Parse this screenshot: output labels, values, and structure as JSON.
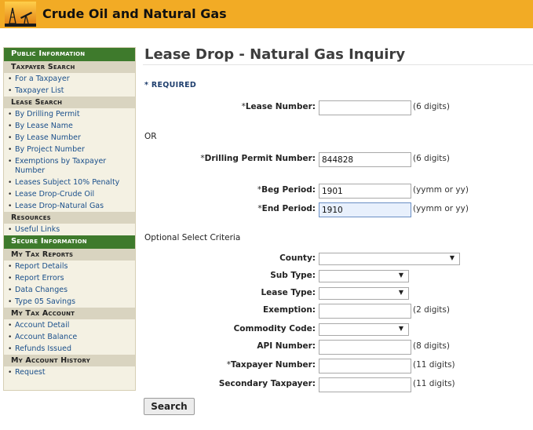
{
  "header": {
    "title": "Crude Oil and Natural Gas",
    "logo_icon": "oil-derrick-icon",
    "color": "#f2ab25"
  },
  "sidebar": {
    "public_heading": "Public Information",
    "taxpayer_search": {
      "heading": "Taxpayer Search",
      "items": [
        "For a Taxpayer",
        "Taxpayer List"
      ]
    },
    "lease_search": {
      "heading": "Lease Search",
      "items": [
        "By Drilling Permit",
        "By Lease Name",
        "By Lease Number",
        "By Project Number",
        "Exemptions by Taxpayer Number",
        "Leases Subject 10% Penalty",
        "Lease Drop-Crude Oil",
        "Lease Drop-Natural Gas"
      ]
    },
    "resources": {
      "heading": "Resources",
      "items": [
        "Useful Links"
      ]
    },
    "secure_heading": "Secure Information",
    "my_tax_reports": {
      "heading": "My Tax Reports",
      "items": [
        "Report Details",
        "Report Errors",
        "Data Changes",
        "Type 05 Savings"
      ]
    },
    "my_tax_account": {
      "heading": "My Tax Account",
      "items": [
        "Account Detail",
        "Account Balance",
        "Refunds Issued"
      ]
    },
    "my_account_history": {
      "heading": "My Account History",
      "items": [
        "Request"
      ]
    }
  },
  "main": {
    "title": "Lease Drop - Natural Gas Inquiry",
    "required_note": "* REQUIRED",
    "or_label": "OR",
    "optional_label": "Optional Select Criteria",
    "search_button": "Search"
  },
  "form": {
    "lease_number": {
      "label": "Lease Number:",
      "required": "*",
      "value": "",
      "hint": "(6 digits)"
    },
    "drilling_permit": {
      "label": "Drilling Permit Number:",
      "required": "*",
      "value": "844828",
      "hint": "(6 digits)"
    },
    "beg_period": {
      "label": "Beg Period:",
      "required": "*",
      "value": "1901",
      "hint": "(yymm or yy)"
    },
    "end_period": {
      "label": "End Period:",
      "required": "*",
      "value": "1910",
      "hint": "(yymm or yy)"
    },
    "county": {
      "label": "County:",
      "value": ""
    },
    "sub_type": {
      "label": "Sub Type:",
      "value": ""
    },
    "lease_type": {
      "label": "Lease Type:",
      "value": ""
    },
    "exemption": {
      "label": "Exemption:",
      "value": "",
      "hint": "(2 digits)"
    },
    "commodity_code": {
      "label": "Commodity Code:",
      "value": ""
    },
    "api_number": {
      "label": "API Number:",
      "value": "",
      "hint": "(8 digits)"
    },
    "taxpayer_number": {
      "label": "Taxpayer Number:",
      "required": "*",
      "value": "",
      "hint": "(11 digits)"
    },
    "secondary_taxpayer": {
      "label": "Secondary Taxpayer:",
      "value": "",
      "hint": "(11 digits)"
    }
  }
}
